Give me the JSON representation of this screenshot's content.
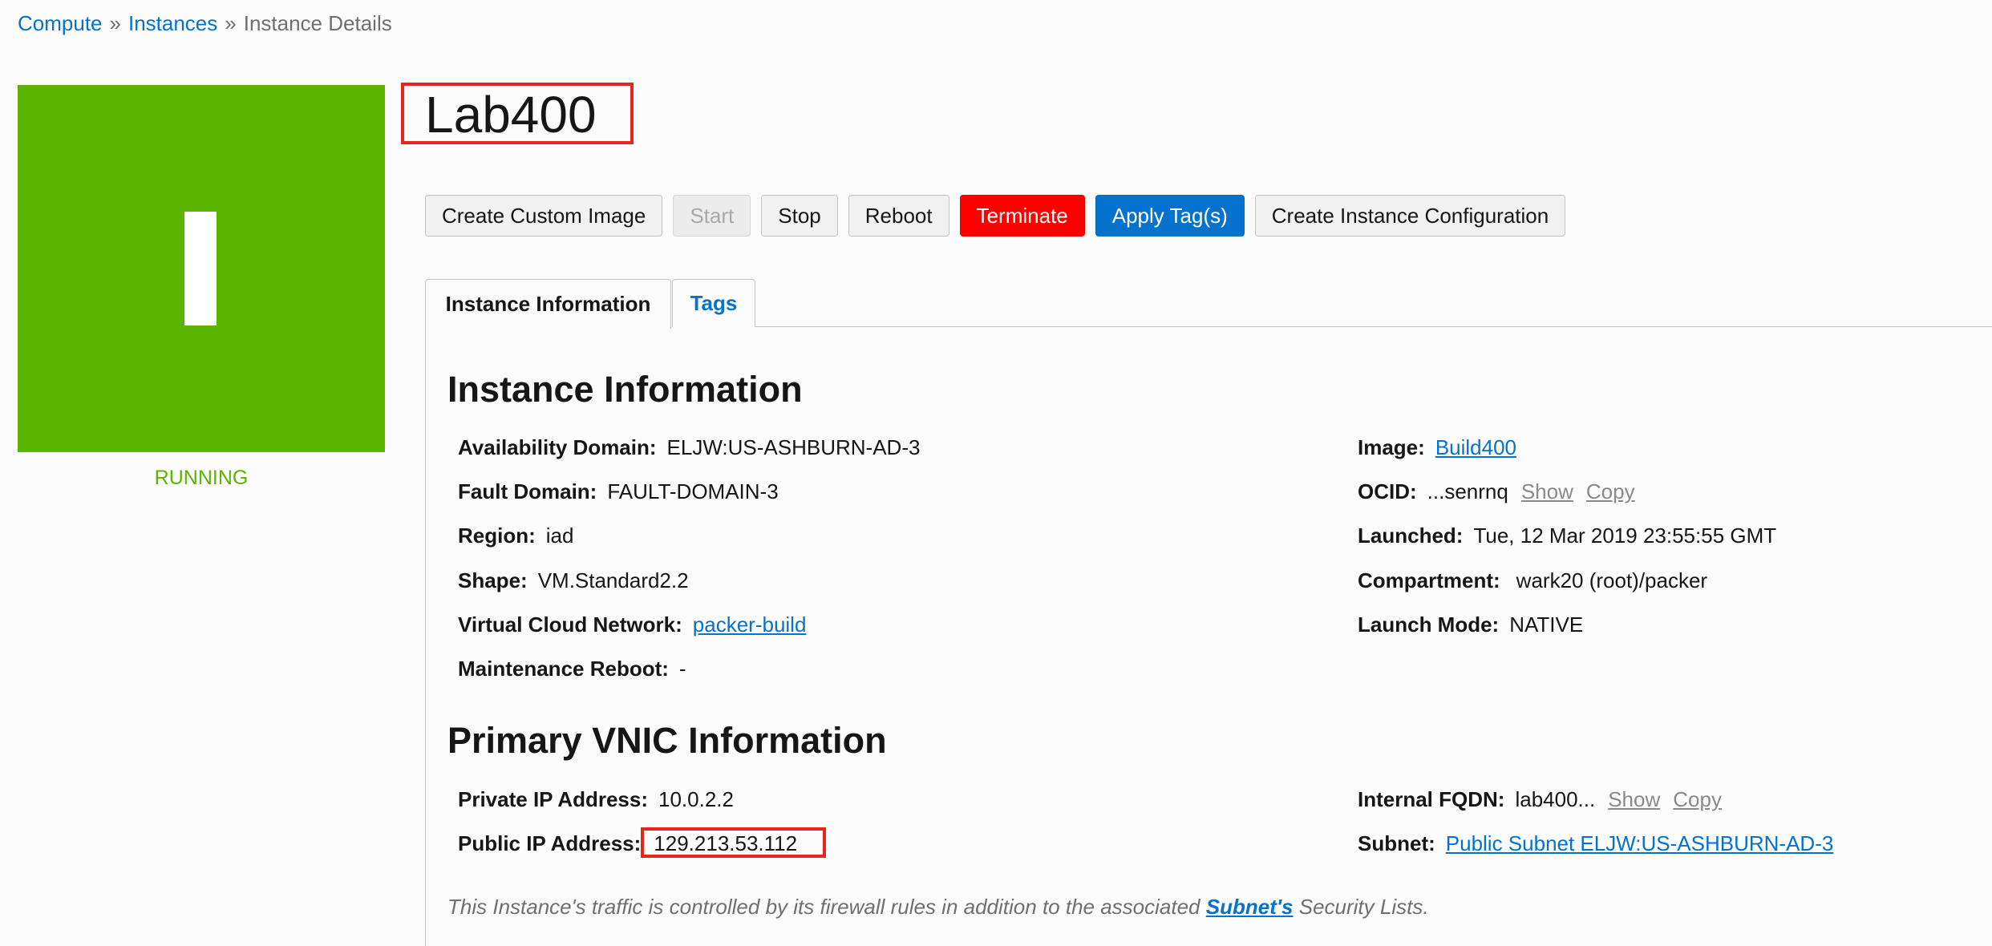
{
  "breadcrumb": {
    "items": [
      "Compute",
      "Instances",
      "Instance Details"
    ],
    "separator": "»"
  },
  "status": {
    "letter": "I",
    "label": "RUNNING",
    "color": "#5bb500"
  },
  "instance": {
    "name": "Lab400"
  },
  "toolbar": {
    "create_custom_image": "Create Custom Image",
    "start": "Start",
    "stop": "Stop",
    "reboot": "Reboot",
    "terminate": "Terminate",
    "apply_tags": "Apply Tag(s)",
    "create_instance_configuration": "Create Instance Configuration"
  },
  "tabs": [
    {
      "label": "Instance Information",
      "active": true
    },
    {
      "label": "Tags",
      "active": false
    }
  ],
  "instance_info": {
    "heading": "Instance Information",
    "left": [
      {
        "label": "Availability Domain:",
        "value": "ELJW:US-ASHBURN-AD-3"
      },
      {
        "label": "Fault Domain:",
        "value": "FAULT-DOMAIN-3"
      },
      {
        "label": "Region:",
        "value": "iad"
      },
      {
        "label": "Shape:",
        "value": "VM.Standard2.2"
      },
      {
        "label": "Virtual Cloud Network:",
        "value": "packer-build"
      },
      {
        "label": "Maintenance Reboot:",
        "value": "-"
      }
    ],
    "right": [
      {
        "label": "Image:",
        "value": "Build400"
      },
      {
        "label": "OCID:",
        "value": "...senrnq",
        "show": "Show",
        "copy": "Copy"
      },
      {
        "label": "Launched:",
        "value": "Tue, 12 Mar 2019 23:55:55 GMT"
      },
      {
        "label": "Compartment:",
        "value": "wark20 (root)/packer"
      },
      {
        "label": "Launch Mode:",
        "value": "NATIVE"
      }
    ]
  },
  "vnic_info": {
    "heading": "Primary VNIC Information",
    "private_ip": {
      "label": "Private IP Address:",
      "value": "10.0.2.2"
    },
    "public_ip": {
      "label": "Public IP Address:",
      "value": "129.213.53.112"
    },
    "internal_fqdn": {
      "label": "Internal FQDN:",
      "value": "lab400...",
      "show": "Show",
      "copy": "Copy"
    },
    "subnet": {
      "label": "Subnet:",
      "value": "Public Subnet ELJW:US-ASHBURN-AD-3"
    }
  },
  "footnote": {
    "before": "This Instance's traffic is controlled by its firewall rules in addition to the associated ",
    "link": "Subnet's",
    "after": " Security Lists."
  }
}
